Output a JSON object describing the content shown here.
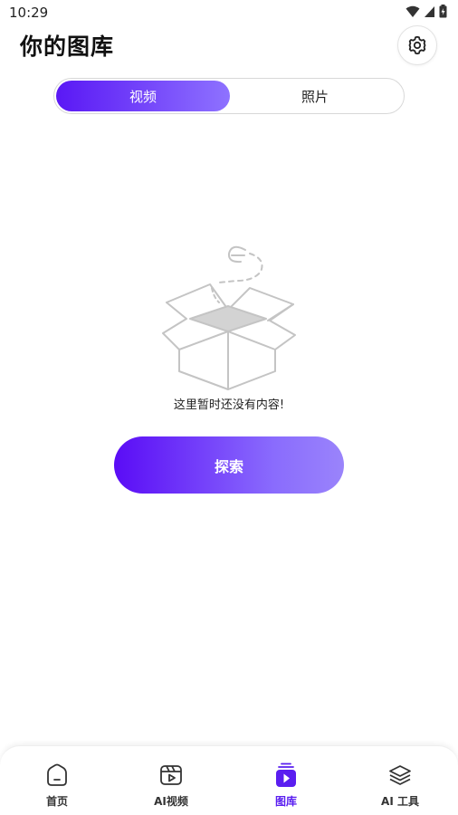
{
  "status_bar": {
    "time": "10:29"
  },
  "header": {
    "title": "你的图库",
    "settings_icon": "gear-icon"
  },
  "tabs": [
    {
      "label": "视频",
      "active": true
    },
    {
      "label": "照片",
      "active": false
    }
  ],
  "empty_state": {
    "illustration": "empty-box-icon",
    "message": "这里暂时还没有内容!",
    "button_label": "探索"
  },
  "bottom_nav": [
    {
      "label": "首页",
      "icon": "home-icon",
      "active": false
    },
    {
      "label": "AI视频",
      "icon": "film-icon",
      "active": false
    },
    {
      "label": "图库",
      "icon": "gallery-icon",
      "active": true
    },
    {
      "label": "AI 工具",
      "icon": "layers-icon",
      "active": false
    }
  ],
  "colors": {
    "accent": "#5a18f5",
    "accent_light": "#8e72ff"
  }
}
